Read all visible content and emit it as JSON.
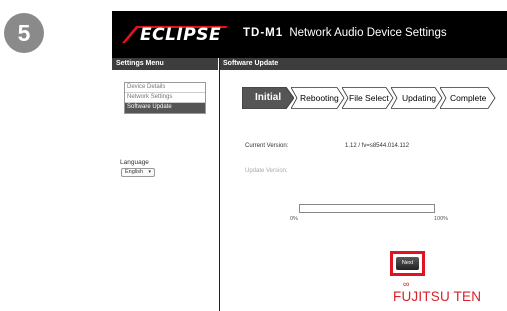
{
  "step_number": "5",
  "header": {
    "logo": "ECLIPSE",
    "model": "TD-M1",
    "title": "Network Audio Device Settings"
  },
  "sidebar": {
    "title": "Settings Menu",
    "items": [
      {
        "label": "Device Details",
        "active": false
      },
      {
        "label": "Network Settings",
        "active": false
      },
      {
        "label": "Software Update",
        "active": true
      }
    ],
    "language_label": "Language",
    "language_value": "English"
  },
  "main": {
    "title": "Software Update",
    "steps": [
      {
        "label": "Initial",
        "active": true
      },
      {
        "label": "Rebooting",
        "active": false
      },
      {
        "label": "File Select",
        "active": false
      },
      {
        "label": "Updating",
        "active": false
      },
      {
        "label": "Complete",
        "active": false
      }
    ],
    "current_version_label": "Current Version:",
    "current_version_value": "1.12 / fv=s8544.014.112",
    "update_version_label": "Update Version:",
    "progress": {
      "value": 0,
      "min_label": "0%",
      "max_label": "100%"
    },
    "next_button": "Next"
  },
  "footer": {
    "maker_logo": "FUJITSU TEN"
  },
  "colors": {
    "header_bg": "#000000",
    "bar_bg": "#3d3d3d",
    "highlight": "#e0141e",
    "brand_red": "#d8202a",
    "progress_fill": "#3a6fb0"
  }
}
